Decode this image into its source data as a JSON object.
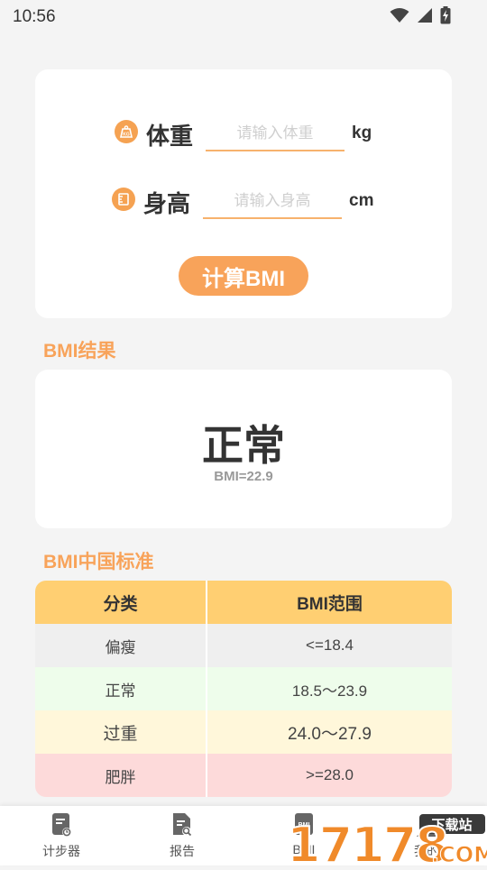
{
  "status_bar": {
    "time": "10:56"
  },
  "form": {
    "weight": {
      "label": "体重",
      "placeholder": "请输入体重",
      "value": "",
      "unit": "kg"
    },
    "height": {
      "label": "身高",
      "placeholder": "请输入身高",
      "value": "",
      "unit": "cm"
    },
    "calculate_label": "计算BMI"
  },
  "result": {
    "section_title": "BMI结果",
    "status": "正常",
    "value_text": "BMI=22.9"
  },
  "standard": {
    "section_title": "BMI中国标准",
    "headers": [
      "分类",
      "BMI范围"
    ],
    "rows": [
      {
        "category": "偏瘦",
        "range": "<=18.4",
        "color": "#efefef"
      },
      {
        "category": "正常",
        "range": "18.5～23.9",
        "color": "#eefdeb"
      },
      {
        "category": "过重",
        "range": "24.0～27.9",
        "color": "#fff7da"
      },
      {
        "category": "肥胖",
        "range": ">=28.0",
        "color": "#fddada"
      }
    ]
  },
  "nav": {
    "items": [
      {
        "label": "计步器",
        "icon": "pedometer-icon"
      },
      {
        "label": "报告",
        "icon": "report-icon"
      },
      {
        "label": "BMI",
        "icon": "bmi-icon"
      },
      {
        "label": "我的",
        "icon": "profile-icon"
      }
    ]
  },
  "watermark": {
    "text": "17178",
    "sub_text": "下载站",
    "domain": ".COM"
  },
  "colors": {
    "accent": "#f8a35a",
    "table_header": "#ffcf72"
  }
}
